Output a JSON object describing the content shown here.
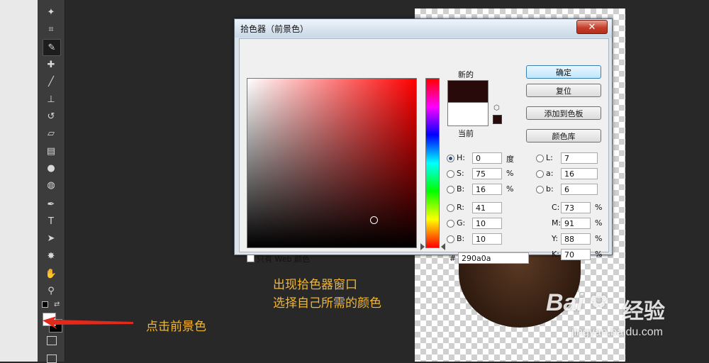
{
  "toolbar": {
    "tools": [
      {
        "name": "magic-wand-icon",
        "glyph": "✦"
      },
      {
        "name": "crop-icon",
        "glyph": "⌗"
      },
      {
        "name": "eyedropper-icon",
        "glyph": "✎"
      },
      {
        "name": "healing-brush-icon",
        "glyph": "✚"
      },
      {
        "name": "brush-icon",
        "glyph": "╱"
      },
      {
        "name": "stamp-icon",
        "glyph": "⊥"
      },
      {
        "name": "history-brush-icon",
        "glyph": "↺"
      },
      {
        "name": "eraser-icon",
        "glyph": "▱"
      },
      {
        "name": "gradient-icon",
        "glyph": "▤"
      },
      {
        "name": "blur-icon",
        "glyph": "●"
      },
      {
        "name": "dodge-icon",
        "glyph": "◍"
      },
      {
        "name": "pen-icon",
        "glyph": "✒"
      },
      {
        "name": "type-icon",
        "glyph": "T"
      },
      {
        "name": "path-select-icon",
        "glyph": "➤"
      },
      {
        "name": "shape-icon",
        "glyph": "✸"
      },
      {
        "name": "hand-icon",
        "glyph": "✋"
      },
      {
        "name": "zoom-icon",
        "glyph": "⚲"
      }
    ],
    "active_tool": "eyedropper-icon",
    "foreground_color": "#ffffff",
    "background_color": "#000000"
  },
  "dialog": {
    "title": "拾色器（前景色）",
    "close_glyph": "✕",
    "new_label": "新的",
    "current_label": "当前",
    "new_color": "#290a0a",
    "current_color": "#ffffff",
    "buttons": {
      "ok": "确定",
      "reset": "复位",
      "add_to_swatches": "添加到色板",
      "color_libraries": "颜色库"
    },
    "hsb": [
      {
        "label": "H:",
        "value": "0",
        "unit": "度",
        "checked": true
      },
      {
        "label": "S:",
        "value": "75",
        "unit": "%",
        "checked": false
      },
      {
        "label": "B:",
        "value": "16",
        "unit": "%",
        "checked": false
      }
    ],
    "rgb": [
      {
        "label": "R:",
        "value": "41"
      },
      {
        "label": "G:",
        "value": "10"
      },
      {
        "label": "B:",
        "value": "10"
      }
    ],
    "lab": [
      {
        "label": "L:",
        "value": "7"
      },
      {
        "label": "a:",
        "value": "16"
      },
      {
        "label": "b:",
        "value": "6"
      }
    ],
    "cmyk": [
      {
        "label": "C:",
        "value": "73",
        "unit": "%"
      },
      {
        "label": "M:",
        "value": "91",
        "unit": "%"
      },
      {
        "label": "Y:",
        "value": "88",
        "unit": "%"
      },
      {
        "label": "K:",
        "value": "70",
        "unit": "%"
      }
    ],
    "hex_label": "#",
    "hex_value": "290a0a",
    "web_only_label": "只有 Web 颜色",
    "field_hue_color": "#ff0000"
  },
  "annotations": {
    "click_foreground": "点击前景色",
    "line1": "出现拾色器窗口",
    "line2": "选择自己所需的颜色",
    "accent_color": "#f2b632"
  },
  "watermark": {
    "logo": "Bai",
    "jingyan": "经验",
    "url": "jingyan.baidu.com"
  }
}
